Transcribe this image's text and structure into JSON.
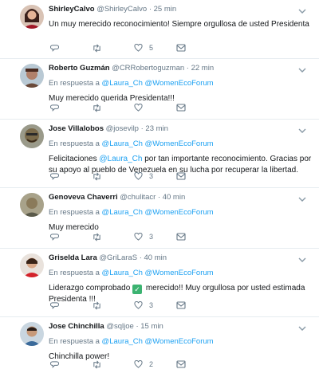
{
  "colors": {
    "link": "#1da1f2",
    "secondary": "#657786",
    "text": "#14171a",
    "divider": "#e6ecf0"
  },
  "icons": {
    "reply": "reply-icon",
    "retweet": "retweet-icon",
    "like": "heart-icon",
    "more": "chevron-down-icon"
  },
  "replies": [
    {
      "name": "ShirleyCalvo",
      "handle": "@ShirleyCalvo",
      "time": "· 25 min",
      "reply_prefix": "En respuesta a",
      "reply_to": "@Laura_Ch @WomenEcoForum",
      "text_before": "Un muy merecido reconocimiento!  Siempre orgullosa de usted Presidenta",
      "text_mention": "",
      "text_after": "",
      "likes": "5"
    },
    {
      "name": "Roberto Guzmán",
      "handle": "@CRRobertoguzman",
      "time": "· 22 min",
      "reply_prefix": "En respuesta a",
      "reply_to": "@Laura_Ch @WomenEcoForum",
      "text_before": "Muy merecido querida Presidenta!!!",
      "text_mention": "",
      "text_after": "",
      "likes": ""
    },
    {
      "name": "Jose Villalobos",
      "handle": "@josevilp",
      "time": "· 23 min",
      "reply_prefix": "En respuesta a",
      "reply_to": "@Laura_Ch @WomenEcoForum",
      "text_before": "Felicitaciones ",
      "text_mention": "@Laura_Ch",
      "text_after": " por tan importante reconocimiento. Gracias por su apoyo al pueblo de Venezuela en su lucha por recuperar la libertad.",
      "likes": "3"
    },
    {
      "name": "Genoveva Chaverri",
      "handle": "@chulitacr",
      "time": "· 40 min",
      "reply_prefix": "En respuesta a",
      "reply_to": "@Laura_Ch @WomenEcoForum",
      "text_before": "Muy merecido",
      "text_mention": "",
      "text_after": "",
      "likes": "3"
    },
    {
      "name": "Griselda Lara",
      "handle": "@GriLaraS",
      "time": "· 40 min",
      "reply_prefix": "En respuesta a",
      "reply_to": "@Laura_Ch @WomenEcoForum",
      "text_before": "Liderazgo comprobado ",
      "text_check": "✓",
      "text_mention": "",
      "text_after": " merecido!! Muy orgullosa por usted estimada Presidenta !!!",
      "likes": "3"
    },
    {
      "name": "Jose Chinchilla",
      "handle": "@sqljoe",
      "time": "· 15 min",
      "reply_prefix": "En respuesta a",
      "reply_to": "@Laura_Ch @WomenEcoForum",
      "text_before": "Chinchilla power!",
      "text_mention": "",
      "text_after": "",
      "likes": "2"
    }
  ]
}
